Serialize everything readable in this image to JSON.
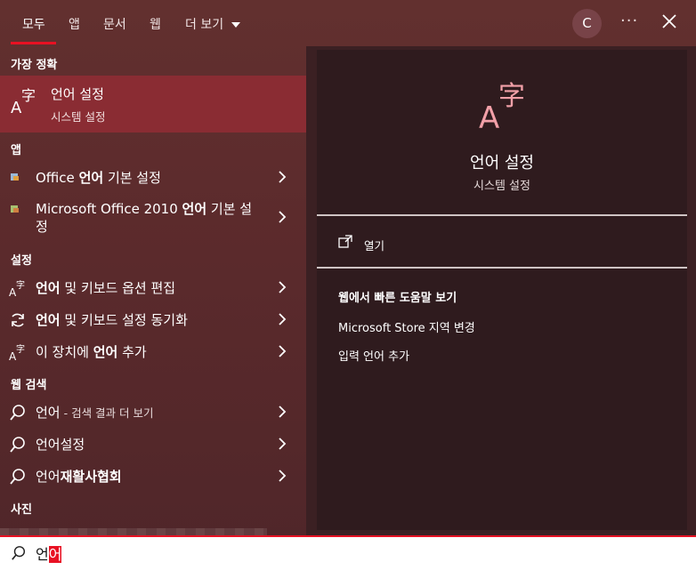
{
  "tabs": [
    {
      "label": "모두"
    },
    {
      "label": "앱"
    },
    {
      "label": "문서"
    },
    {
      "label": "웹"
    },
    {
      "label": "더 보기"
    }
  ],
  "user_initial": "C",
  "sections": {
    "best": "가장 정확",
    "apps": "앱",
    "settings": "설정",
    "web": "웹 검색",
    "photos": "사진"
  },
  "best_match": {
    "title": "언어 설정",
    "subtitle": "시스템 설정"
  },
  "apps": [
    {
      "pre": "Office ",
      "bold": "언어",
      "post": " 기본 설정"
    },
    {
      "line1_pre": "Microsoft Office 2010 ",
      "line1_bold": "언어",
      "line1_post": " 기본 설",
      "line2": "정"
    }
  ],
  "settings": [
    {
      "pre": "",
      "bold": "언어",
      "post": " 및 키보드 옵션 편집"
    },
    {
      "pre": "",
      "bold": "언어",
      "post": " 및 키보드 설정 동기화"
    },
    {
      "pre": "이 장치에 ",
      "bold": "언어",
      "post": " 추가"
    }
  ],
  "web": [
    {
      "pre": "언어",
      "bold": "",
      "post": "",
      "small": " - 검색 결과 더 보기"
    },
    {
      "pre": "언어설정",
      "bold": "",
      "post": "",
      "small": ""
    },
    {
      "pre": "언어",
      "bold": "재활사협회",
      "post": "",
      "small": ""
    }
  ],
  "preview": {
    "title": "언어 설정",
    "subtitle": "시스템 설정",
    "open": "열기",
    "web_heading": "웹에서 빠른 도움말 보기",
    "links": [
      "Microsoft Store 지역 변경",
      "입력 언어 추가"
    ]
  },
  "search": {
    "normal": "언",
    "selected": "어"
  },
  "colors": {
    "accent": "#e81123",
    "best_bg": "#8a2c33",
    "glyph_pink": "#f2a0a8"
  }
}
